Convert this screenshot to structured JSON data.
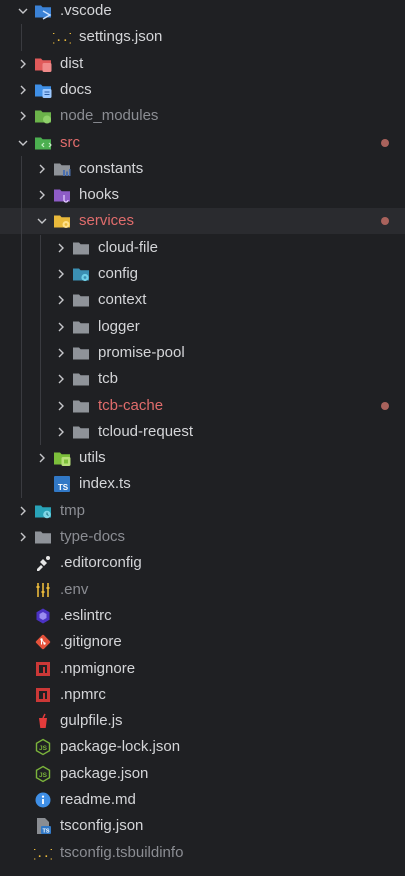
{
  "explorer": {
    "items": [
      {
        "label": "vscode",
        "prefix": ".",
        "depth": 0,
        "kind": "folder",
        "expanded": true,
        "icon": "vscode-folder-icon",
        "style": "normal",
        "modified": false
      },
      {
        "label": "settings.json",
        "depth": 1,
        "kind": "file",
        "icon": "json-braces-icon",
        "style": "normal",
        "modified": false
      },
      {
        "label": "dist",
        "depth": 0,
        "kind": "folder",
        "expanded": false,
        "icon": "dist-folder-icon",
        "style": "normal",
        "modified": false
      },
      {
        "label": "docs",
        "depth": 0,
        "kind": "folder",
        "expanded": false,
        "icon": "docs-folder-icon",
        "style": "normal",
        "modified": false
      },
      {
        "label": "node_modules",
        "depth": 0,
        "kind": "folder",
        "expanded": false,
        "icon": "node-folder-icon",
        "style": "dim",
        "modified": false
      },
      {
        "label": "src",
        "depth": 0,
        "kind": "folder",
        "expanded": true,
        "icon": "src-folder-icon",
        "style": "mod",
        "modified": true
      },
      {
        "label": "constants",
        "depth": 1,
        "kind": "folder",
        "expanded": false,
        "icon": "constants-folder-icon",
        "style": "normal",
        "modified": false
      },
      {
        "label": "hooks",
        "depth": 1,
        "kind": "folder",
        "expanded": false,
        "icon": "hooks-folder-icon",
        "style": "normal",
        "modified": false
      },
      {
        "label": "services",
        "depth": 1,
        "kind": "folder",
        "expanded": true,
        "icon": "services-folder-icon",
        "style": "mod",
        "modified": true
      },
      {
        "label": "cloud-file",
        "depth": 2,
        "kind": "folder",
        "expanded": false,
        "icon": "folder-icon",
        "style": "normal",
        "modified": false
      },
      {
        "label": "config",
        "depth": 2,
        "kind": "folder",
        "expanded": false,
        "icon": "config-folder-icon",
        "style": "normal",
        "modified": false
      },
      {
        "label": "context",
        "depth": 2,
        "kind": "folder",
        "expanded": false,
        "icon": "folder-icon",
        "style": "normal",
        "modified": false
      },
      {
        "label": "logger",
        "depth": 2,
        "kind": "folder",
        "expanded": false,
        "icon": "folder-icon",
        "style": "normal",
        "modified": false
      },
      {
        "label": "promise-pool",
        "depth": 2,
        "kind": "folder",
        "expanded": false,
        "icon": "folder-icon",
        "style": "normal",
        "modified": false
      },
      {
        "label": "tcb",
        "depth": 2,
        "kind": "folder",
        "expanded": false,
        "icon": "folder-icon",
        "style": "normal",
        "modified": false
      },
      {
        "label": "tcb-cache",
        "depth": 2,
        "kind": "folder",
        "expanded": false,
        "icon": "folder-icon",
        "style": "mod",
        "modified": true
      },
      {
        "label": "tcloud-request",
        "depth": 2,
        "kind": "folder",
        "expanded": false,
        "icon": "folder-icon",
        "style": "normal",
        "modified": false
      },
      {
        "label": "utils",
        "depth": 1,
        "kind": "folder",
        "expanded": false,
        "icon": "utils-folder-icon",
        "style": "normal",
        "modified": false
      },
      {
        "label": "index.ts",
        "depth": 1,
        "kind": "file",
        "icon": "typescript-icon",
        "style": "normal",
        "modified": false
      },
      {
        "label": "tmp",
        "depth": 0,
        "kind": "folder",
        "expanded": false,
        "icon": "tmp-folder-icon",
        "style": "dim",
        "modified": false
      },
      {
        "label": "type-docs",
        "depth": 0,
        "kind": "folder",
        "expanded": false,
        "icon": "folder-icon",
        "style": "dim",
        "modified": false
      },
      {
        "label": ".editorconfig",
        "depth": 0,
        "kind": "file",
        "icon": "editorconfig-icon",
        "style": "normal",
        "modified": false
      },
      {
        "label": ".env",
        "depth": 0,
        "kind": "file",
        "icon": "env-icon",
        "style": "dim",
        "modified": false
      },
      {
        "label": ".eslintrc",
        "depth": 0,
        "kind": "file",
        "icon": "eslint-icon",
        "style": "normal",
        "modified": false
      },
      {
        "label": ".gitignore",
        "depth": 0,
        "kind": "file",
        "icon": "git-icon",
        "style": "normal",
        "modified": false
      },
      {
        "label": ".npmignore",
        "depth": 0,
        "kind": "file",
        "icon": "npm-icon",
        "style": "normal",
        "modified": false
      },
      {
        "label": ".npmrc",
        "depth": 0,
        "kind": "file",
        "icon": "npm-icon",
        "style": "normal",
        "modified": false
      },
      {
        "label": "gulpfile.js",
        "depth": 0,
        "kind": "file",
        "icon": "gulp-icon",
        "style": "normal",
        "modified": false
      },
      {
        "label": "package-lock.json",
        "depth": 0,
        "kind": "file",
        "icon": "nodejs-icon",
        "style": "normal",
        "modified": false
      },
      {
        "label": "package.json",
        "depth": 0,
        "kind": "file",
        "icon": "nodejs-icon",
        "style": "normal",
        "modified": false
      },
      {
        "label": "readme.md",
        "depth": 0,
        "kind": "file",
        "icon": "info-icon",
        "style": "normal",
        "modified": false
      },
      {
        "label": "tsconfig.json",
        "depth": 0,
        "kind": "file",
        "icon": "tsconfig-icon",
        "style": "normal",
        "modified": false
      },
      {
        "label": "tsconfig.tsbuildinfo",
        "depth": 0,
        "kind": "file",
        "icon": "json-braces-icon",
        "style": "dim",
        "modified": false
      }
    ]
  },
  "colors": {
    "background": "#1f2023",
    "selected_row": "#2a2b2f",
    "text": "#d4d5d8",
    "text_dim": "#8b8d93",
    "text_modified": "#e06c6c",
    "modified_dot": "#a9625c",
    "folder_gray": "#8f9399",
    "vscode_blue": "#3b82d6",
    "dist_red": "#e05a5a",
    "docs_blue": "#3f8fe6",
    "node_green": "#6bb34a",
    "src_green": "#4caf50",
    "services_yellow": "#e9b93b",
    "utils_green": "#7cbf3b",
    "ts_blue": "#3178c6",
    "tmp_cyan": "#29a3b8"
  }
}
